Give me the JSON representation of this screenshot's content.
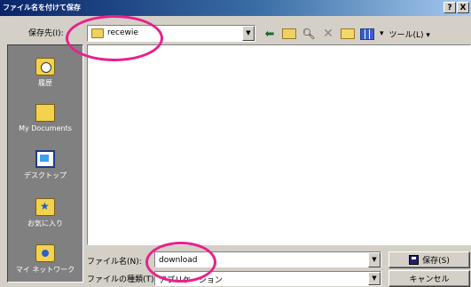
{
  "window": {
    "title": "ファイル名を付けて保存",
    "help_button": "?",
    "close_button": "X"
  },
  "look_in": {
    "label": "保存先(I):",
    "value": "recewie"
  },
  "toolbar": {
    "back_icon": "back-arrow-icon",
    "up_icon": "up-folder-icon",
    "search_web_icon": "search-web-icon",
    "delete_icon": "delete-icon",
    "new_folder_icon": "new-folder-icon",
    "views_icon": "views-icon",
    "views_arrow": "▾",
    "tools_label": "ツール(L) ▾"
  },
  "places": [
    {
      "label": "履歴",
      "icon": "history-icon"
    },
    {
      "label": "My Documents",
      "icon": "my-documents-icon"
    },
    {
      "label": "デスクトップ",
      "icon": "desktop-icon"
    },
    {
      "label": "お気に入り",
      "icon": "favorites-icon"
    },
    {
      "label": "マイ ネットワーク",
      "icon": "network-icon"
    }
  ],
  "file_name": {
    "label": "ファイル名(N):",
    "value": "download"
  },
  "file_type": {
    "label": "ファイルの種類(T):",
    "value": "アプリケーション"
  },
  "buttons": {
    "save": "保存(S)",
    "cancel": "キャンセル"
  },
  "highlight_color": "#e8218b"
}
